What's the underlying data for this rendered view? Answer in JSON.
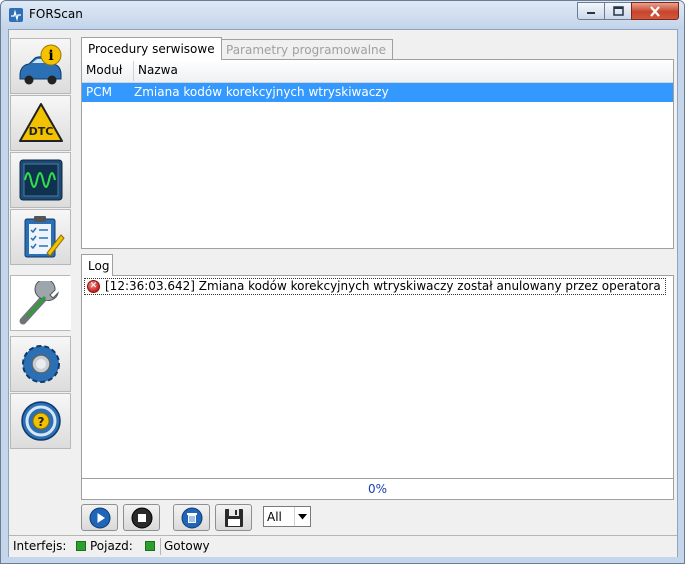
{
  "window": {
    "title": "FORScan"
  },
  "sidebar": {
    "items": [
      {
        "icon": "vehicle-info-icon",
        "active": false
      },
      {
        "icon": "dtc-icon",
        "active": false
      },
      {
        "icon": "oscilloscope-icon",
        "active": false
      },
      {
        "icon": "checklist-icon",
        "active": false
      },
      {
        "icon": "wrench-icon",
        "active": true
      },
      {
        "icon": "settings-gear-icon",
        "active": false
      },
      {
        "icon": "help-icon",
        "active": false
      }
    ]
  },
  "tabs": {
    "service": "Procedury serwisowe",
    "programming": "Parametry programowalne"
  },
  "grid": {
    "headers": {
      "module": "Moduł",
      "name": "Nazwa"
    },
    "rows": [
      {
        "module": "PCM",
        "name": "Zmiana kodów korekcyjnych wtryskiwaczy"
      }
    ]
  },
  "log": {
    "tab_label": "Log",
    "entries": [
      {
        "icon": "error-icon",
        "text": "[12:36:03.642] Zmiana kodów korekcyjnych wtryskiwaczy został anulowany przez operatora"
      }
    ]
  },
  "progress": {
    "value": 0,
    "label": "0%"
  },
  "toolbar": {
    "filter_value": "All",
    "buttons": [
      "play-icon",
      "stop-icon",
      "trash-icon",
      "save-icon"
    ]
  },
  "status": {
    "interface_label": "Interfejs:",
    "vehicle_label": "Pojazd:",
    "state": "Gotowy",
    "colors": {
      "led": "#2ca02c",
      "selection": "#3399ff"
    }
  }
}
